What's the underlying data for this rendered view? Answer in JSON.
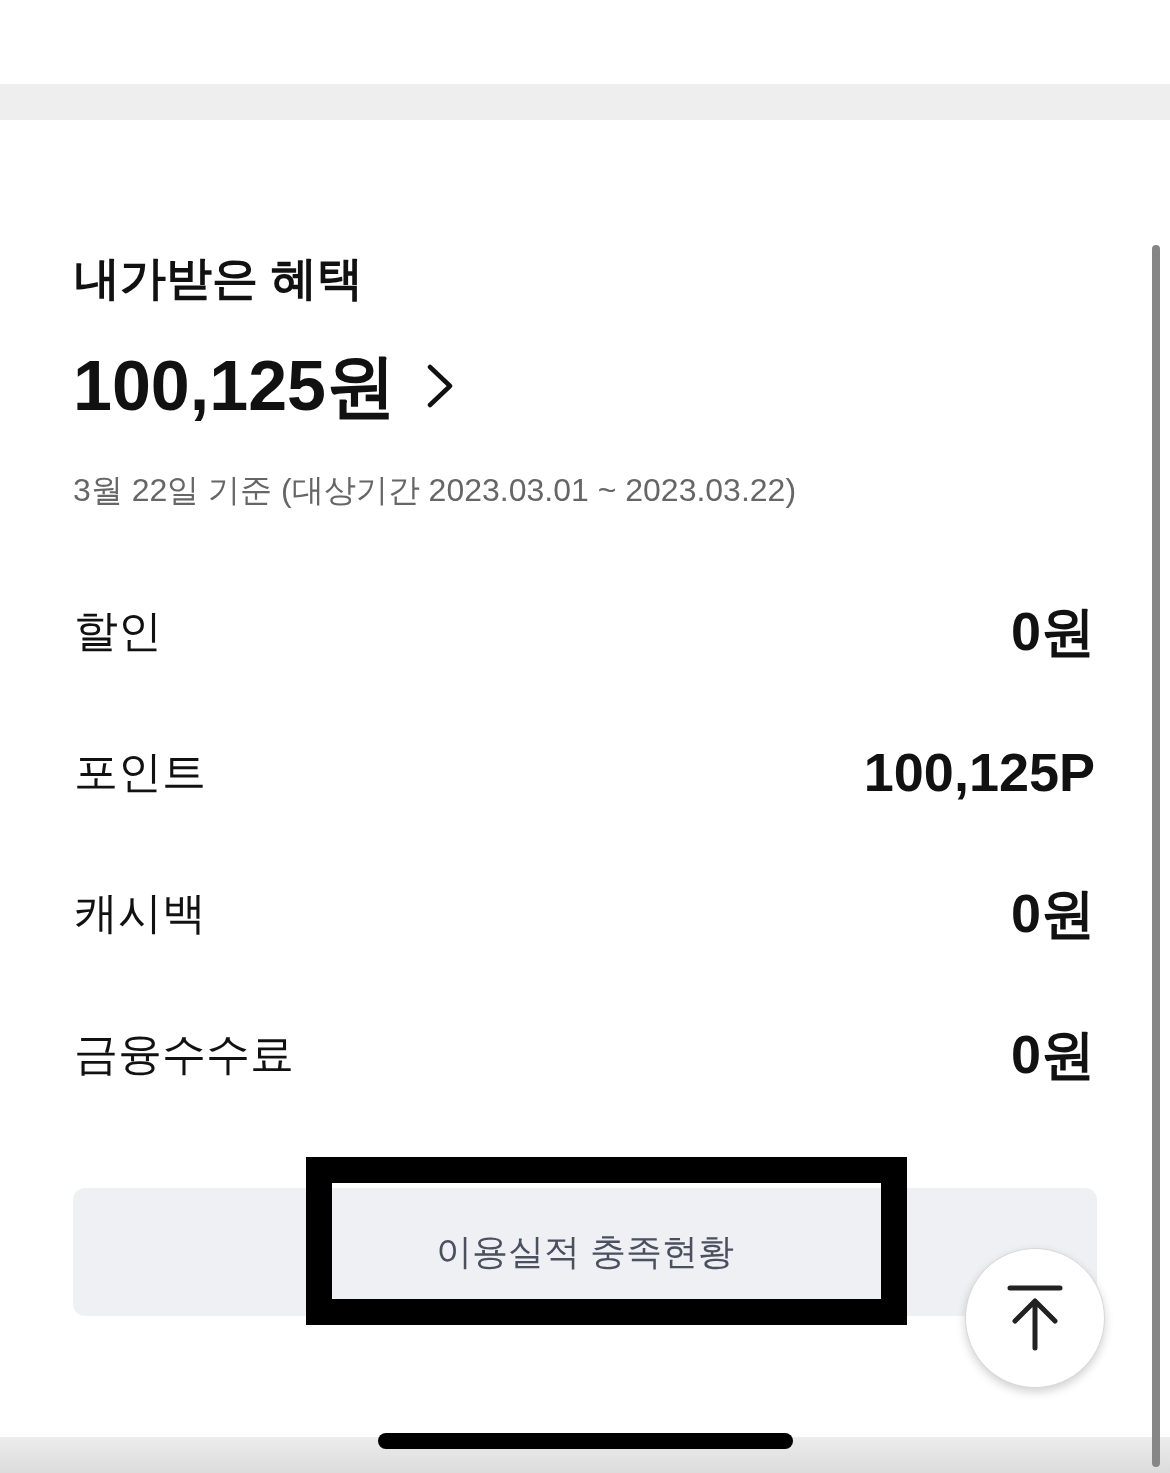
{
  "benefits": {
    "title": "내가받은 혜택",
    "total": "100,125원",
    "basis_note": "3월 22일 기준 (대상기간 2023.03.01 ~ 2023.03.22)"
  },
  "breakdown": [
    {
      "label": "할인",
      "value": "0원"
    },
    {
      "label": "포인트",
      "value": "100,125P"
    },
    {
      "label": "캐시백",
      "value": "0원"
    },
    {
      "label": "금융수수료",
      "value": "0원"
    }
  ],
  "performance_button": {
    "label": "이용실적 충족현황",
    "highlighted": true
  }
}
